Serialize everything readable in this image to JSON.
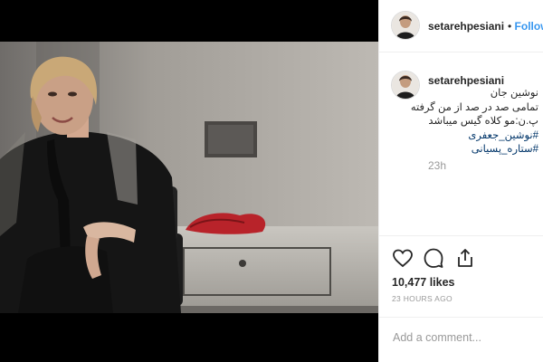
{
  "post": {
    "username": "setarehpesiani",
    "follow_separator": "•",
    "follow_label": "Follow",
    "caption_lines": [
      "نوشین جان",
      "تمامی صد در صد از من گرفته",
      "پ.ن:مو کلاه گیس میباشد"
    ],
    "hashtags": [
      "#نوشین_جعفری",
      "#ستاره_پسیانی"
    ],
    "comment_time": "23h",
    "likes": "10,477 likes",
    "post_time": "23 HOURS AGO",
    "add_comment_placeholder": "Add a comment..."
  },
  "icons": {
    "like": "heart-icon",
    "comment": "speech-bubble-icon",
    "share": "share-icon",
    "avatar": "profile-avatar"
  },
  "colors": {
    "link": "#3897f0",
    "hashtag": "#003569",
    "muted": "#999999",
    "text": "#262626",
    "border": "#efefef"
  }
}
